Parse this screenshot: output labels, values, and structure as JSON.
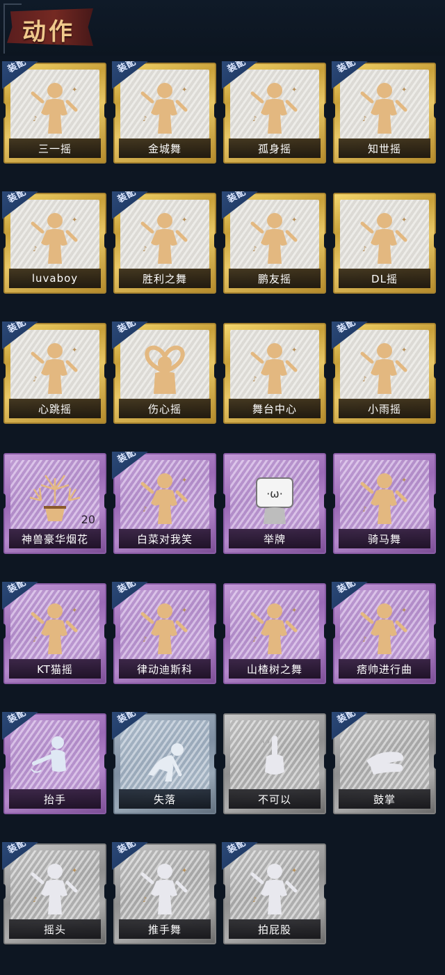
{
  "header": {
    "title": "动作"
  },
  "badge_text": "装配",
  "cards": [
    {
      "label": "三一摇",
      "tier": "gold",
      "equipped": true,
      "icon": "dancer-icon"
    },
    {
      "label": "金城舞",
      "tier": "gold",
      "equipped": true,
      "icon": "dancer-icon"
    },
    {
      "label": "孤身摇",
      "tier": "gold",
      "equipped": true,
      "icon": "dancer-icon"
    },
    {
      "label": "知世摇",
      "tier": "gold",
      "equipped": true,
      "icon": "dancer-icon"
    },
    {
      "label": "luvaboy",
      "tier": "gold",
      "equipped": true,
      "icon": "dancer-icon"
    },
    {
      "label": "胜利之舞",
      "tier": "gold",
      "equipped": true,
      "icon": "dancer-icon"
    },
    {
      "label": "鹏友摇",
      "tier": "gold",
      "equipped": true,
      "icon": "dancer-icon"
    },
    {
      "label": "DL摇",
      "tier": "gold",
      "equipped": false,
      "icon": "dancer-icon"
    },
    {
      "label": "心跳摇",
      "tier": "gold",
      "equipped": true,
      "icon": "dancer-icon"
    },
    {
      "label": "伤心摇",
      "tier": "gold",
      "equipped": true,
      "icon": "heart-hands-icon"
    },
    {
      "label": "舞台中心",
      "tier": "gold",
      "equipped": false,
      "icon": "dancer-icon"
    },
    {
      "label": "小雨摇",
      "tier": "gold",
      "equipped": true,
      "icon": "dancer-icon"
    },
    {
      "label": "神兽豪华烟花",
      "tier": "purple",
      "equipped": false,
      "icon": "fireworks-icon",
      "count": "20"
    },
    {
      "label": "白菜对我笑",
      "tier": "purple",
      "equipped": true,
      "icon": "dancer-icon"
    },
    {
      "label": "举牌",
      "tier": "purple",
      "equipped": false,
      "icon": "sign-icon"
    },
    {
      "label": "骑马舞",
      "tier": "purple",
      "equipped": false,
      "icon": "dancer-icon"
    },
    {
      "label": "KT猫摇",
      "tier": "purple",
      "equipped": true,
      "icon": "dancer-icon"
    },
    {
      "label": "律动迪斯科",
      "tier": "purple",
      "equipped": true,
      "icon": "dancer-icon"
    },
    {
      "label": "山楂树之舞",
      "tier": "purple",
      "equipped": false,
      "icon": "dancer-icon"
    },
    {
      "label": "痞帅进行曲",
      "tier": "purple",
      "equipped": true,
      "icon": "dancer-icon"
    },
    {
      "label": "抬手",
      "tier": "purple",
      "equipped": true,
      "icon": "raise-hand-icon"
    },
    {
      "label": "失落",
      "tier": "blue",
      "equipped": true,
      "icon": "kneel-icon"
    },
    {
      "label": "不可以",
      "tier": "gray",
      "equipped": false,
      "icon": "finger-wag-icon"
    },
    {
      "label": "鼓掌",
      "tier": "gray",
      "equipped": true,
      "icon": "clap-icon"
    },
    {
      "label": "摇头",
      "tier": "gray",
      "equipped": true,
      "icon": "dancer-icon"
    },
    {
      "label": "推手舞",
      "tier": "gray",
      "equipped": true,
      "icon": "dancer-icon"
    },
    {
      "label": "拍屁股",
      "tier": "gray",
      "equipped": true,
      "icon": "dancer-icon"
    }
  ]
}
